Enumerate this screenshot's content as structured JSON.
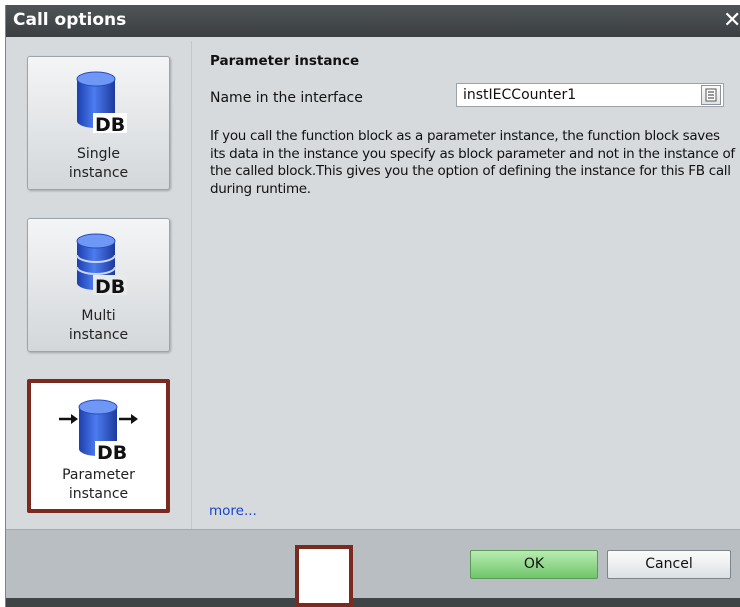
{
  "dialog": {
    "title": "Call options",
    "close_glyph": "✕"
  },
  "options": [
    {
      "label": "Single\ninstance",
      "badge": "DB",
      "icon": "database-icon"
    },
    {
      "label": "Multi\ninstance",
      "badge": "DB",
      "icon": "database-icon"
    },
    {
      "label": "Parameter\ninstance",
      "badge": "DB",
      "icon": "database-arrows-icon",
      "selected": true
    }
  ],
  "panel": {
    "section_title": "Parameter instance",
    "field_label": "Name in the interface",
    "field_value": "instIECCounter1",
    "description": "If you call the function block as a parameter instance, the function block saves its data in the instance you specify as block parameter and not in the instance of the called block.This gives you the option of defining the instance for this FB call during runtime.",
    "more_link": "more..."
  },
  "footer": {
    "ok_label": "OK",
    "cancel_label": "Cancel"
  },
  "colors": {
    "accent_highlight": "#7a2a1e",
    "db_blue": "#2f5fd6",
    "ok_green": "#6fc56a"
  }
}
